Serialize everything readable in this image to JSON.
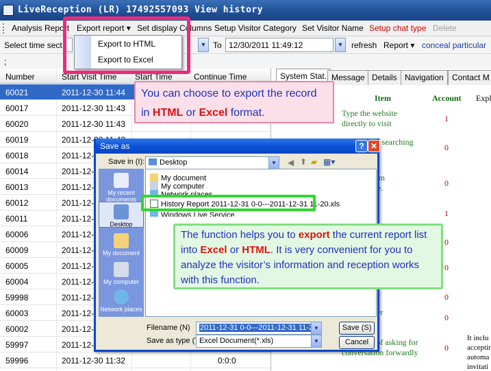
{
  "window": {
    "title": "LiveReception (LR) 17492557093  View history"
  },
  "menubar": {
    "items": [
      {
        "label": "Analysis Report"
      },
      {
        "label": "Export report"
      },
      {
        "label": "Set display Columns"
      },
      {
        "label": "Setup Visitor Category"
      },
      {
        "label": "Set Visitor Name"
      },
      {
        "label": "Setup chat type"
      },
      {
        "label": "Delete"
      }
    ]
  },
  "export_menu": {
    "options": [
      "Export to HTML",
      "Export to Excel"
    ]
  },
  "filter": {
    "time_label": "Select time sect",
    "to_label": "To",
    "to_value": "12/30/2011 11:49:12",
    "refresh": "refresh",
    "report": "Report",
    "conceal": "conceal particular"
  },
  "strip3": ";",
  "grid": {
    "headers": [
      "Number",
      "Start Visit Time",
      "Start Time",
      "Continue Time"
    ],
    "rows": [
      {
        "number": "60021",
        "time": "2011-12-30 11:44",
        "cont": ""
      },
      {
        "number": "60017",
        "time": "2011-12-30 11:43",
        "cont": ""
      },
      {
        "number": "60020",
        "time": "2011-12-30 11:43",
        "cont": ""
      },
      {
        "number": "60019",
        "time": "2011-12-30 11:43",
        "cont": ""
      },
      {
        "number": "60018",
        "time": "2011-12-30 11:4",
        "cont": ""
      },
      {
        "number": "60014",
        "time": "2011-12-30 11:4",
        "cont": ""
      },
      {
        "number": "60013",
        "time": "2011-12-30 11:4",
        "cont": ""
      },
      {
        "number": "60012",
        "time": "2011-12-30 11:4",
        "cont": ""
      },
      {
        "number": "60011",
        "time": "2011-12-30 11:4",
        "cont": ""
      },
      {
        "number": "60006",
        "time": "2011-12-30 11:4",
        "cont": ""
      },
      {
        "number": "60009",
        "time": "2011-12-30 11:4",
        "cont": ""
      },
      {
        "number": "60005",
        "time": "2011-12-30 11:4",
        "cont": ""
      },
      {
        "number": "60004",
        "time": "2011-12-30 11:4",
        "cont": ""
      },
      {
        "number": "59998",
        "time": "2011-12-30 11:4",
        "cont": ""
      },
      {
        "number": "60003",
        "time": "2011-12-30 11:4",
        "cont": ""
      },
      {
        "number": "60002",
        "time": "2011-12-30 11:4",
        "cont": ""
      },
      {
        "number": "59997",
        "time": "2011-12-30 11:4",
        "cont": ""
      },
      {
        "number": "59996",
        "time": "2011-12-30 11:32",
        "cont": "0:0:0"
      }
    ]
  },
  "right_panel": {
    "tabs": [
      "System Stat.",
      "Message",
      "Details",
      "Navigation",
      "Contact M"
    ],
    "headers": {
      "item": "Item",
      "account": "Account",
      "explain": "Expl"
    },
    "stats": [
      {
        "item": "Type the website directly to visit",
        "account": "1"
      },
      {
        "item": "our website searching",
        "account": "0"
      },
      {
        "item": "website from interlinkage.",
        "account": "0"
      },
      {
        "item": "e no dialog",
        "account": "1"
      },
      {
        "item": "",
        "account": "0"
      },
      {
        "item": "",
        "account": "0"
      },
      {
        "item": "",
        "account": "0"
      },
      {
        "item": "alog number",
        "account": "0"
      },
      {
        "item": "e the time of asking for conversation forwardly",
        "account": "0"
      }
    ],
    "explain_text": "It inclu acceptir automa invitati"
  },
  "callout1": {
    "line1": "You can choose to export the record",
    "pre": "in ",
    "hot1": "HTML",
    "mid": " or ",
    "hot2": "Excel",
    "post": " format."
  },
  "dialog": {
    "title": "Save as",
    "save_in_label": "Save in (I):",
    "save_in_value": "Desktop",
    "places": [
      "My recent documents",
      "Desktop",
      "My document",
      "My computer",
      "Network places"
    ],
    "files": [
      "My document",
      "My computer",
      "Network places",
      "History Report 2011-12-31 0-0---2011-12-31 11-20.xls",
      "Windows Live Service"
    ],
    "filename_label": "Filename (N)",
    "filename_value": "2011-12-31 0-0---2011-12-31 11-20.xls",
    "type_label": "Save as type (T)",
    "type_value": "Excel Document(*.xls)",
    "save_btn": "Save (S)",
    "cancel_btn": "Cancel"
  },
  "callout2": {
    "pre": "The function helps you to ",
    "hot1": "export",
    "mid1": " the current report list into ",
    "hot2": "Excel",
    "mid2": " or ",
    "hot3": "HTML",
    "post": ". It is very convenient for you to analyze the visitor’s information and reception works with this function."
  },
  "colors": {
    "accent": "#ee2a7b",
    "selection": "#3169c6",
    "callout_green": "#7fe07f",
    "title_blue": "#1f4f96"
  }
}
